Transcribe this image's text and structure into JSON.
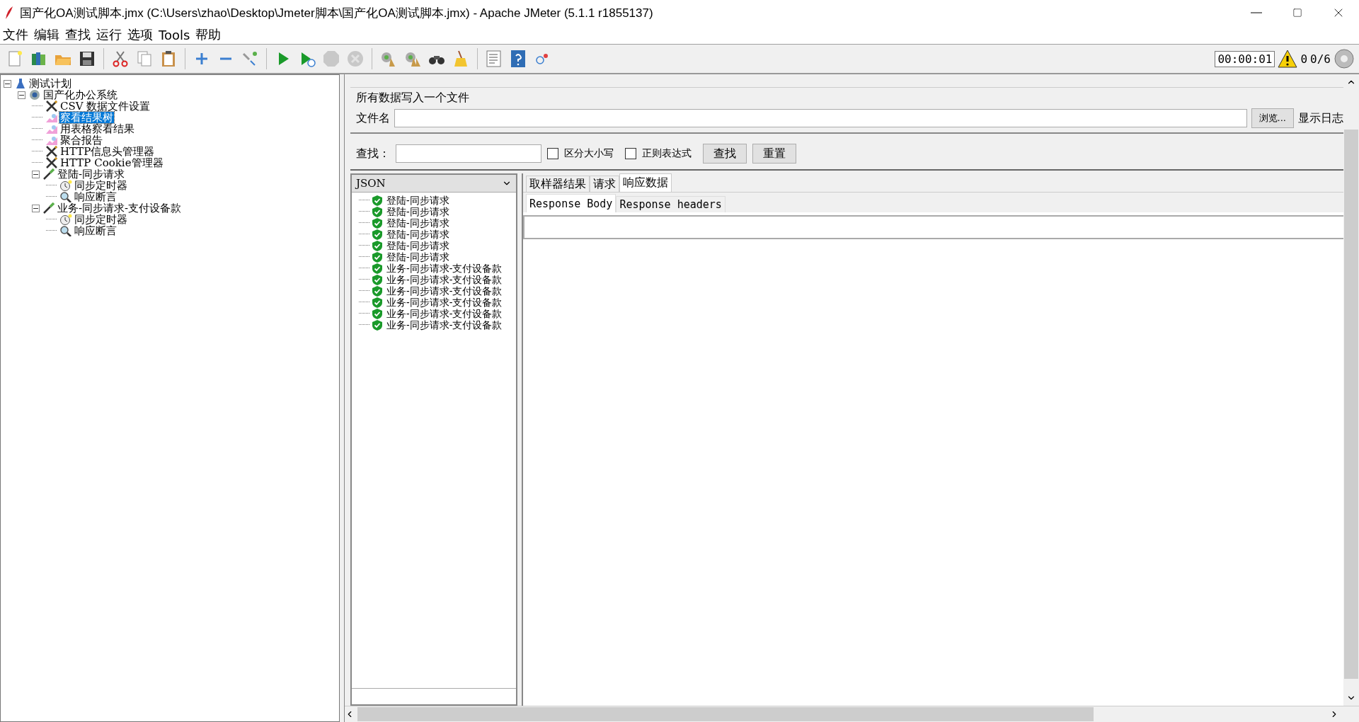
{
  "window": {
    "title": "国产化OA测试脚本.jmx (C:\\Users\\zhao\\Desktop\\Jmeter脚本\\国产化OA测试脚本.jmx) - Apache JMeter (5.1.1 r1855137)"
  },
  "menu": [
    {
      "label": "文件"
    },
    {
      "label": "编辑"
    },
    {
      "label": "查找"
    },
    {
      "label": "运行"
    },
    {
      "label": "选项"
    },
    {
      "label": "Tools"
    },
    {
      "label": "帮助"
    }
  ],
  "toolbar": {
    "buttons": [
      {
        "kind": "new",
        "disabled": false
      },
      {
        "kind": "templates",
        "disabled": false
      },
      {
        "kind": "open",
        "disabled": false
      },
      {
        "kind": "save",
        "disabled": false
      },
      {
        "kind": "sep"
      },
      {
        "kind": "cut",
        "disabled": false
      },
      {
        "kind": "copy",
        "disabled": false
      },
      {
        "kind": "paste",
        "disabled": false
      },
      {
        "kind": "sep"
      },
      {
        "kind": "expand",
        "disabled": false
      },
      {
        "kind": "collapse",
        "disabled": false
      },
      {
        "kind": "toggle",
        "disabled": false
      },
      {
        "kind": "sep"
      },
      {
        "kind": "start",
        "disabled": false
      },
      {
        "kind": "start-no-timers",
        "disabled": false
      },
      {
        "kind": "stop",
        "disabled": true
      },
      {
        "kind": "shutdown",
        "disabled": true
      },
      {
        "kind": "sep"
      },
      {
        "kind": "clear",
        "disabled": false
      },
      {
        "kind": "clear-all",
        "disabled": false
      },
      {
        "kind": "search",
        "disabled": false
      },
      {
        "kind": "reset-search",
        "disabled": false
      },
      {
        "kind": "sep"
      },
      {
        "kind": "function",
        "disabled": false
      },
      {
        "kind": "help",
        "disabled": false
      },
      {
        "kind": "remote",
        "disabled": false
      }
    ],
    "timer": "00:00:01",
    "warnings": "0",
    "threads": "0/6"
  },
  "tree": [
    {
      "label": "测试计划",
      "kind": "plan",
      "selected": false,
      "expanded": true,
      "children": [
        {
          "label": "国产化办公系统",
          "kind": "group",
          "selected": false,
          "expanded": true,
          "children": [
            {
              "label": "CSV 数据文件设置",
              "kind": "config",
              "selected": false
            },
            {
              "label": "察看结果树",
              "kind": "listener",
              "selected": true
            },
            {
              "label": "用表格察看结果",
              "kind": "listener",
              "selected": false
            },
            {
              "label": "聚合报告",
              "kind": "listener",
              "selected": false
            },
            {
              "label": "HTTP信息头管理器",
              "kind": "config",
              "selected": false
            },
            {
              "label": "HTTP Cookie管理器",
              "kind": "config",
              "selected": false
            },
            {
              "label": "登陆-同步请求",
              "kind": "sampler",
              "selected": false,
              "expanded": true,
              "children": [
                {
                  "label": "同步定时器",
                  "kind": "timer",
                  "selected": false
                },
                {
                  "label": "响应断言",
                  "kind": "assertion",
                  "selected": false
                }
              ]
            },
            {
              "label": "业务-同步请求-支付设备款",
              "kind": "sampler",
              "selected": false,
              "expanded": true,
              "children": [
                {
                  "label": "同步定时器",
                  "kind": "timer",
                  "selected": false
                },
                {
                  "label": "响应断言",
                  "kind": "assertion",
                  "selected": false
                }
              ]
            }
          ]
        }
      ]
    }
  ],
  "file_panel": {
    "legend": "所有数据写入一个文件",
    "filename_label": "文件名",
    "browse_button": "浏览...",
    "log_label": "显示日志"
  },
  "search": {
    "label": "查找：",
    "case_sensitive": {
      "label": "区分大小写",
      "checked": false
    },
    "regex": {
      "label": "正则表达式",
      "checked": false
    },
    "find_button": "查找",
    "reset_button": "重置"
  },
  "renderer": "JSON",
  "results": [
    {
      "label": "登陆-同步请求"
    },
    {
      "label": "登陆-同步请求"
    },
    {
      "label": "登陆-同步请求"
    },
    {
      "label": "登陆-同步请求"
    },
    {
      "label": "登陆-同步请求"
    },
    {
      "label": "登陆-同步请求"
    },
    {
      "label": "业务-同步请求-支付设备款"
    },
    {
      "label": "业务-同步请求-支付设备款"
    },
    {
      "label": "业务-同步请求-支付设备款"
    },
    {
      "label": "业务-同步请求-支付设备款"
    },
    {
      "label": "业务-同步请求-支付设备款"
    },
    {
      "label": "业务-同步请求-支付设备款"
    }
  ],
  "tabs": [
    {
      "label": "取样器结果",
      "selected": false
    },
    {
      "label": "请求",
      "selected": false
    },
    {
      "label": "响应数据",
      "selected": true
    }
  ],
  "subtabs": [
    {
      "label": "Response Body",
      "selected": true
    },
    {
      "label": "Response headers",
      "selected": false
    }
  ]
}
